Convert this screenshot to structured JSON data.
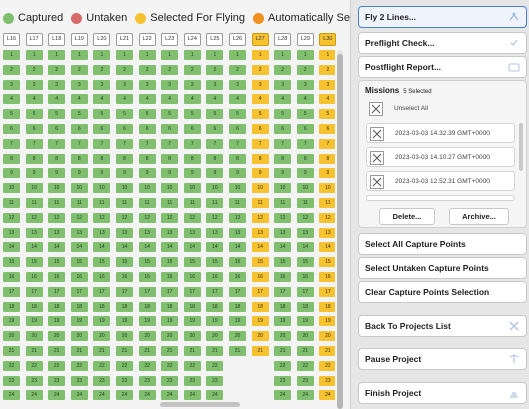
{
  "legend": [
    {
      "label": "Captured",
      "color": "#7fbf6e"
    },
    {
      "label": "Untaken",
      "color": "#d86a6a"
    },
    {
      "label": "Selected For Flying",
      "color": "#f7c230"
    },
    {
      "label": "Automatically Selected For Flying",
      "color": "#f0901e"
    }
  ],
  "columns": [
    "L16",
    "L17",
    "L18",
    "L19",
    "L20",
    "L21",
    "L22",
    "L23",
    "L24",
    "L25",
    "L26",
    "L27",
    "L28",
    "L29",
    "L30"
  ],
  "selected_columns": [
    "L27",
    "L30"
  ],
  "grid": {
    "row_numbers": [
      1,
      2,
      3,
      4,
      5,
      6,
      7,
      8,
      9,
      10,
      11,
      12,
      13,
      14,
      15,
      16,
      17,
      18,
      19,
      20,
      21,
      22,
      23,
      24
    ],
    "selected_column_indexes": [
      11,
      14
    ],
    "short_columns": {
      "10": 21,
      "11": 21,
      "12": 24
    }
  },
  "buttons": {
    "fly": "Fly 2 Lines...",
    "preflight": "Preflight Check...",
    "postflight": "Postflight Report...",
    "select_all": "Select All Capture Points",
    "select_untaken": "Select Untaken Capture Points",
    "clear_selection": "Clear Capture Points Selection",
    "back": "Back To Projects List",
    "pause": "Pause Project",
    "finish": "Finish Project"
  },
  "missions": {
    "title": "Missions",
    "count": "5 Selected",
    "unselect_all": "Unselect All",
    "items": [
      "2023-03-03 14.32.39 GMT+0000",
      "2023-03-03 14.10.27 GMT+0000",
      "2023-03-03 12.52.31 GMT+0000"
    ],
    "delete": "Delete...",
    "archive": "Archive..."
  }
}
